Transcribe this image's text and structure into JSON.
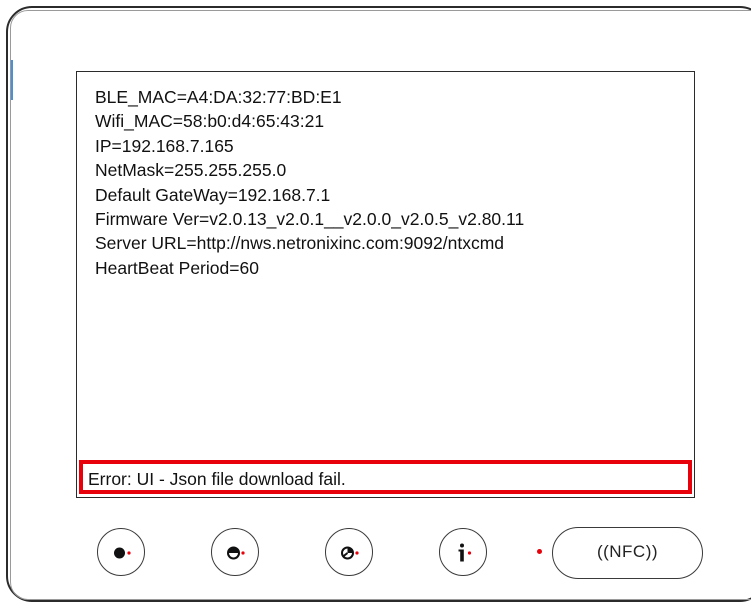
{
  "screen": {
    "lines": [
      "BLE_MAC=A4:DA:32:77:BD:E1",
      "Wifi_MAC=58:b0:d4:65:43:21",
      "IP=192.168.7.165",
      "NetMask=255.255.255.0",
      "Default GateWay=192.168.7.1",
      "Firmware Ver=v2.0.13_v2.0.1__v2.0.0_v2.0.5_v2.80.11",
      "Server URL=http://nws.netronixinc.com:9092/ntxcmd",
      "HeartBeat Period=60"
    ],
    "error_message": "Error: UI - Json file download fail."
  },
  "buttons": {
    "nfc_label": "((NFC))"
  },
  "colors": {
    "error_border": "#e8000b",
    "indicator_dot": "#e8000b",
    "accent": "#4a90d9"
  },
  "icons": {
    "button_1": "full-circle-dot-icon",
    "button_2": "half-circle-dot-icon",
    "button_3": "pie-quarter-dot-icon",
    "button_4": "info-icon"
  }
}
